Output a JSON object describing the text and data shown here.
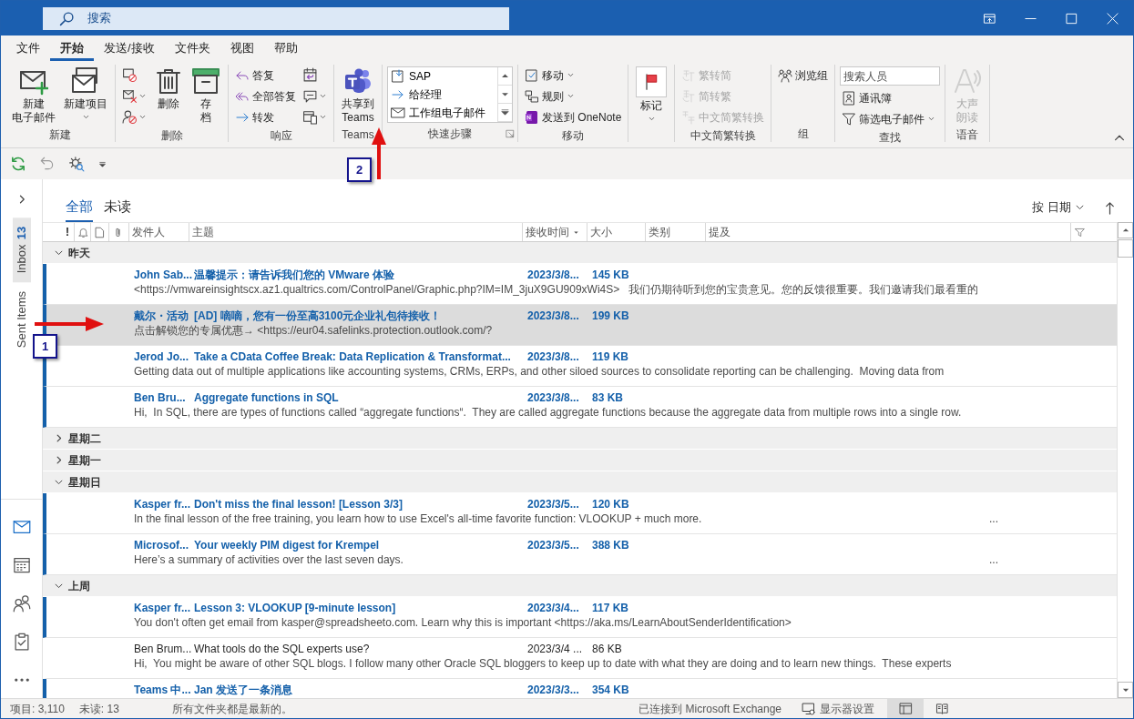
{
  "title_bar": {
    "search_placeholder": "搜索"
  },
  "menu_tabs": [
    {
      "label": "文件",
      "selected": false
    },
    {
      "label": "开始",
      "selected": true
    },
    {
      "label": "发送/接收",
      "selected": false
    },
    {
      "label": "文件夹",
      "selected": false
    },
    {
      "label": "视图",
      "selected": false
    },
    {
      "label": "帮助",
      "selected": false
    }
  ],
  "ribbon": {
    "groups": [
      {
        "label": "新建",
        "launcher": false,
        "stacks": [
          [
            {
              "kind": "large",
              "lines": [
                "新建",
                "电子邮件"
              ],
              "dropdown": false,
              "disabled": false
            }
          ],
          [
            {
              "kind": "large",
              "lines": [
                "新建项目"
              ],
              "dropdown": true,
              "disabled": false
            }
          ]
        ]
      },
      {
        "label": "删除",
        "launcher": false,
        "stacks": [
          [
            {
              "kind": "icon",
              "dropdown": false,
              "disabled": false
            },
            {
              "kind": "icon",
              "dropdown": true,
              "disabled": false
            },
            {
              "kind": "icon",
              "dropdown": true,
              "disabled": false
            }
          ],
          [
            {
              "kind": "large",
              "lines": [
                "删除"
              ],
              "dropdown": false,
              "disabled": false
            }
          ],
          [
            {
              "kind": "large",
              "lines": [
                "存",
                "档"
              ],
              "dropdown": false,
              "disabled": false
            }
          ]
        ]
      },
      {
        "label": "响应",
        "launcher": false,
        "stacks": [
          [
            {
              "kind": "small",
              "label": "答复",
              "dropdown": false,
              "disabled": false
            },
            {
              "kind": "small",
              "label": "全部答复",
              "dropdown": false,
              "disabled": false
            },
            {
              "kind": "small",
              "label": "转发",
              "dropdown": false,
              "disabled": false
            }
          ],
          [
            {
              "kind": "icon",
              "dropdown": false,
              "disabled": false
            },
            {
              "kind": "icon",
              "dropdown": true,
              "disabled": false
            },
            {
              "kind": "icon",
              "dropdown": true,
              "disabled": false
            }
          ]
        ]
      },
      {
        "label": "Teams",
        "launcher": false,
        "stacks": [
          [
            {
              "kind": "large",
              "lines": [
                "共享到",
                "Teams"
              ],
              "dropdown": false,
              "disabled": false
            }
          ]
        ]
      },
      {
        "label": "快速步骤",
        "launcher": true,
        "stacks": [
          [
            {
              "kind": "gallery",
              "entries": [
                {
                  "label": "SAP"
                },
                {
                  "label": "给经理"
                },
                {
                  "label": "工作组电子邮件"
                }
              ]
            }
          ]
        ]
      },
      {
        "label": "移动",
        "launcher": false,
        "stacks": [
          [
            {
              "kind": "small",
              "label": "移动",
              "dropdown": true,
              "disabled": false
            },
            {
              "kind": "small",
              "label": "规则",
              "dropdown": true,
              "disabled": false
            },
            {
              "kind": "small",
              "label": "发送到 OneNote",
              "dropdown": false,
              "disabled": false
            }
          ]
        ]
      },
      {
        "launcher": false,
        "stacks": [
          [
            {
              "kind": "large",
              "lines": [
                "标记"
              ],
              "dropdown": true,
              "disabled": false
            }
          ]
        ]
      },
      {
        "label": "中文简繁转换",
        "launcher": false,
        "stacks": [
          [
            {
              "kind": "small",
              "label": "繁转简",
              "dropdown": false,
              "disabled": true
            },
            {
              "kind": "small",
              "label": "简转繁",
              "dropdown": false,
              "disabled": true
            },
            {
              "kind": "small",
              "label": "中文简繁转换",
              "dropdown": false,
              "disabled": true
            }
          ]
        ]
      },
      {
        "label": "组",
        "launcher": false,
        "stacks": [
          [
            {
              "kind": "small",
              "label": "浏览组",
              "dropdown": false,
              "disabled": false
            }
          ]
        ]
      },
      {
        "label": "查找",
        "launcher": false,
        "stacks": [
          [
            {
              "kind": "search",
              "placeholder": "搜索人员"
            },
            {
              "kind": "small",
              "label": "通讯簿",
              "dropdown": false,
              "disabled": false
            },
            {
              "kind": "small",
              "label": "筛选电子邮件",
              "dropdown": true,
              "disabled": false
            }
          ]
        ]
      },
      {
        "label": "语音",
        "launcher": false,
        "stacks": [
          [
            {
              "kind": "large",
              "lines": [
                "大声",
                "朗读"
              ],
              "dropdown": false,
              "disabled": true
            }
          ]
        ]
      }
    ]
  },
  "folders": [
    {
      "label": "Inbox",
      "count": "13",
      "selected": true
    },
    {
      "label": "Sent Items",
      "selected": false
    }
  ],
  "nav_modules": [
    {
      "selected": true
    },
    {
      "selected": false
    },
    {
      "selected": false
    },
    {
      "selected": false
    },
    {
      "selected": false
    }
  ],
  "filter_tabs": [
    {
      "label": "全部",
      "selected": true
    },
    {
      "label": "未读",
      "selected": false
    }
  ],
  "sort": {
    "label": "按 日期"
  },
  "columns": [
    {
      "kind": "text",
      "label": "!"
    },
    {
      "kind": "icon"
    },
    {
      "kind": "icon"
    },
    {
      "kind": "icon"
    },
    {
      "kind": "text",
      "label": "发件人",
      "sorted": false
    },
    {
      "kind": "text",
      "label": "主题",
      "sorted": false
    },
    {
      "kind": "text",
      "label": "接收时间",
      "sorted": true
    },
    {
      "kind": "text",
      "label": "大小",
      "sorted": false
    },
    {
      "kind": "text",
      "label": "类别",
      "sorted": false
    },
    {
      "kind": "text",
      "label": "提及",
      "sorted": false
    },
    {
      "kind": "icon"
    }
  ],
  "groups": [
    {
      "label": "昨天",
      "expanded": true,
      "messages": [
        {
          "sender": "John Sab...",
          "subject": "温馨提示：请告诉我们您的 VMware 体验",
          "received": "2023/3/8...",
          "size": "145 KB",
          "preview": "<https://vmwareinsightscx.az1.qualtrics.com/ControlPanel/Graphic.php?IM=IM_3juX9GU909xWi4S>   我们仍期待听到您的宝贵意见。您的反馈很重要。我们邀请我们最看重的",
          "unread": true,
          "selected": false
        },
        {
          "sender": "戴尔・活动",
          "subject": "[AD] 嘀嘀，您有一份至高3100元企业礼包待接收！",
          "received": "2023/3/8...",
          "size": "199 KB",
          "preview": "点击解锁您的专属优惠→ <https://eur04.safelinks.protection.outlook.com/?",
          "unread": true,
          "selected": true
        },
        {
          "sender": "Jerod Jo...",
          "subject": "Take a CData Coffee Break: Data Replication & Transformat...",
          "received": "2023/3/8...",
          "size": "119 KB",
          "preview": "Getting data out of multiple applications like accounting systems, CRMs, ERPs, and other siloed sources to consolidate reporting can be challenging.  Moving data from",
          "unread": true,
          "selected": false
        },
        {
          "sender": "Ben Bru...",
          "subject": "Aggregate functions in SQL",
          "received": "2023/3/8...",
          "size": "83 KB",
          "preview": "Hi,  In SQL, there are types of functions called “aggregate functions“.  They are called aggregate functions because the aggregate data from multiple rows into a single row.",
          "unread": true,
          "selected": false
        }
      ]
    },
    {
      "label": "星期二",
      "expanded": false
    },
    {
      "label": "星期一",
      "expanded": false
    },
    {
      "label": "星期日",
      "expanded": true,
      "messages": [
        {
          "sender": "Kasper fr...",
          "subject": "Don't miss the final lesson! [Lesson 3/3]",
          "received": "2023/3/5...",
          "size": "120 KB",
          "preview": "In the final lesson of the free training, you learn how to use Excel's all-time favorite function: VLOOKUP + much more.",
          "tail": "...",
          "unread": true,
          "selected": false
        },
        {
          "sender": "Microsof...",
          "subject": "Your weekly PIM digest for Krempel",
          "received": "2023/3/5...",
          "size": "388 KB",
          "preview": "Here’s a summary of activities over the last seven days.",
          "tail": "...",
          "unread": true,
          "selected": false
        }
      ]
    },
    {
      "label": "上周",
      "expanded": true,
      "messages": [
        {
          "sender": "Kasper fr...",
          "subject": "Lesson 3: VLOOKUP [9-minute lesson]",
          "received": "2023/3/4...",
          "size": "117 KB",
          "preview": "You don't often get email from kasper@spreadsheeto.com. Learn why this is important <https://aka.ms/LearnAboutSenderIdentification>",
          "unread": true,
          "selected": false
        },
        {
          "sender": "Ben Brum...",
          "subject": "What tools do the SQL experts use?",
          "received": "2023/3/4 ...",
          "size": "86 KB",
          "preview": "Hi,  You might be aware of other SQL blogs. I follow many other Oracle SQL bloggers to keep up to date with what they are doing and to learn new things.  These experts",
          "unread": false,
          "selected": false
        },
        {
          "sender": "Teams 中...",
          "subject": "Jan 发送了一条消息",
          "received": "2023/3/3...",
          "size": "354 KB",
          "unread": true,
          "selected": false
        }
      ]
    }
  ],
  "status_bar": {
    "items": "项目: 3,110",
    "unread": "未读: 13",
    "sync": "所有文件夹都是最新的。",
    "connection": "已连接到 Microsoft Exchange",
    "display": "显示器设置",
    "views": [
      {
        "selected": true
      },
      {
        "selected": false
      }
    ]
  },
  "annotations": [
    {
      "label": "1"
    },
    {
      "label": "2"
    }
  ]
}
